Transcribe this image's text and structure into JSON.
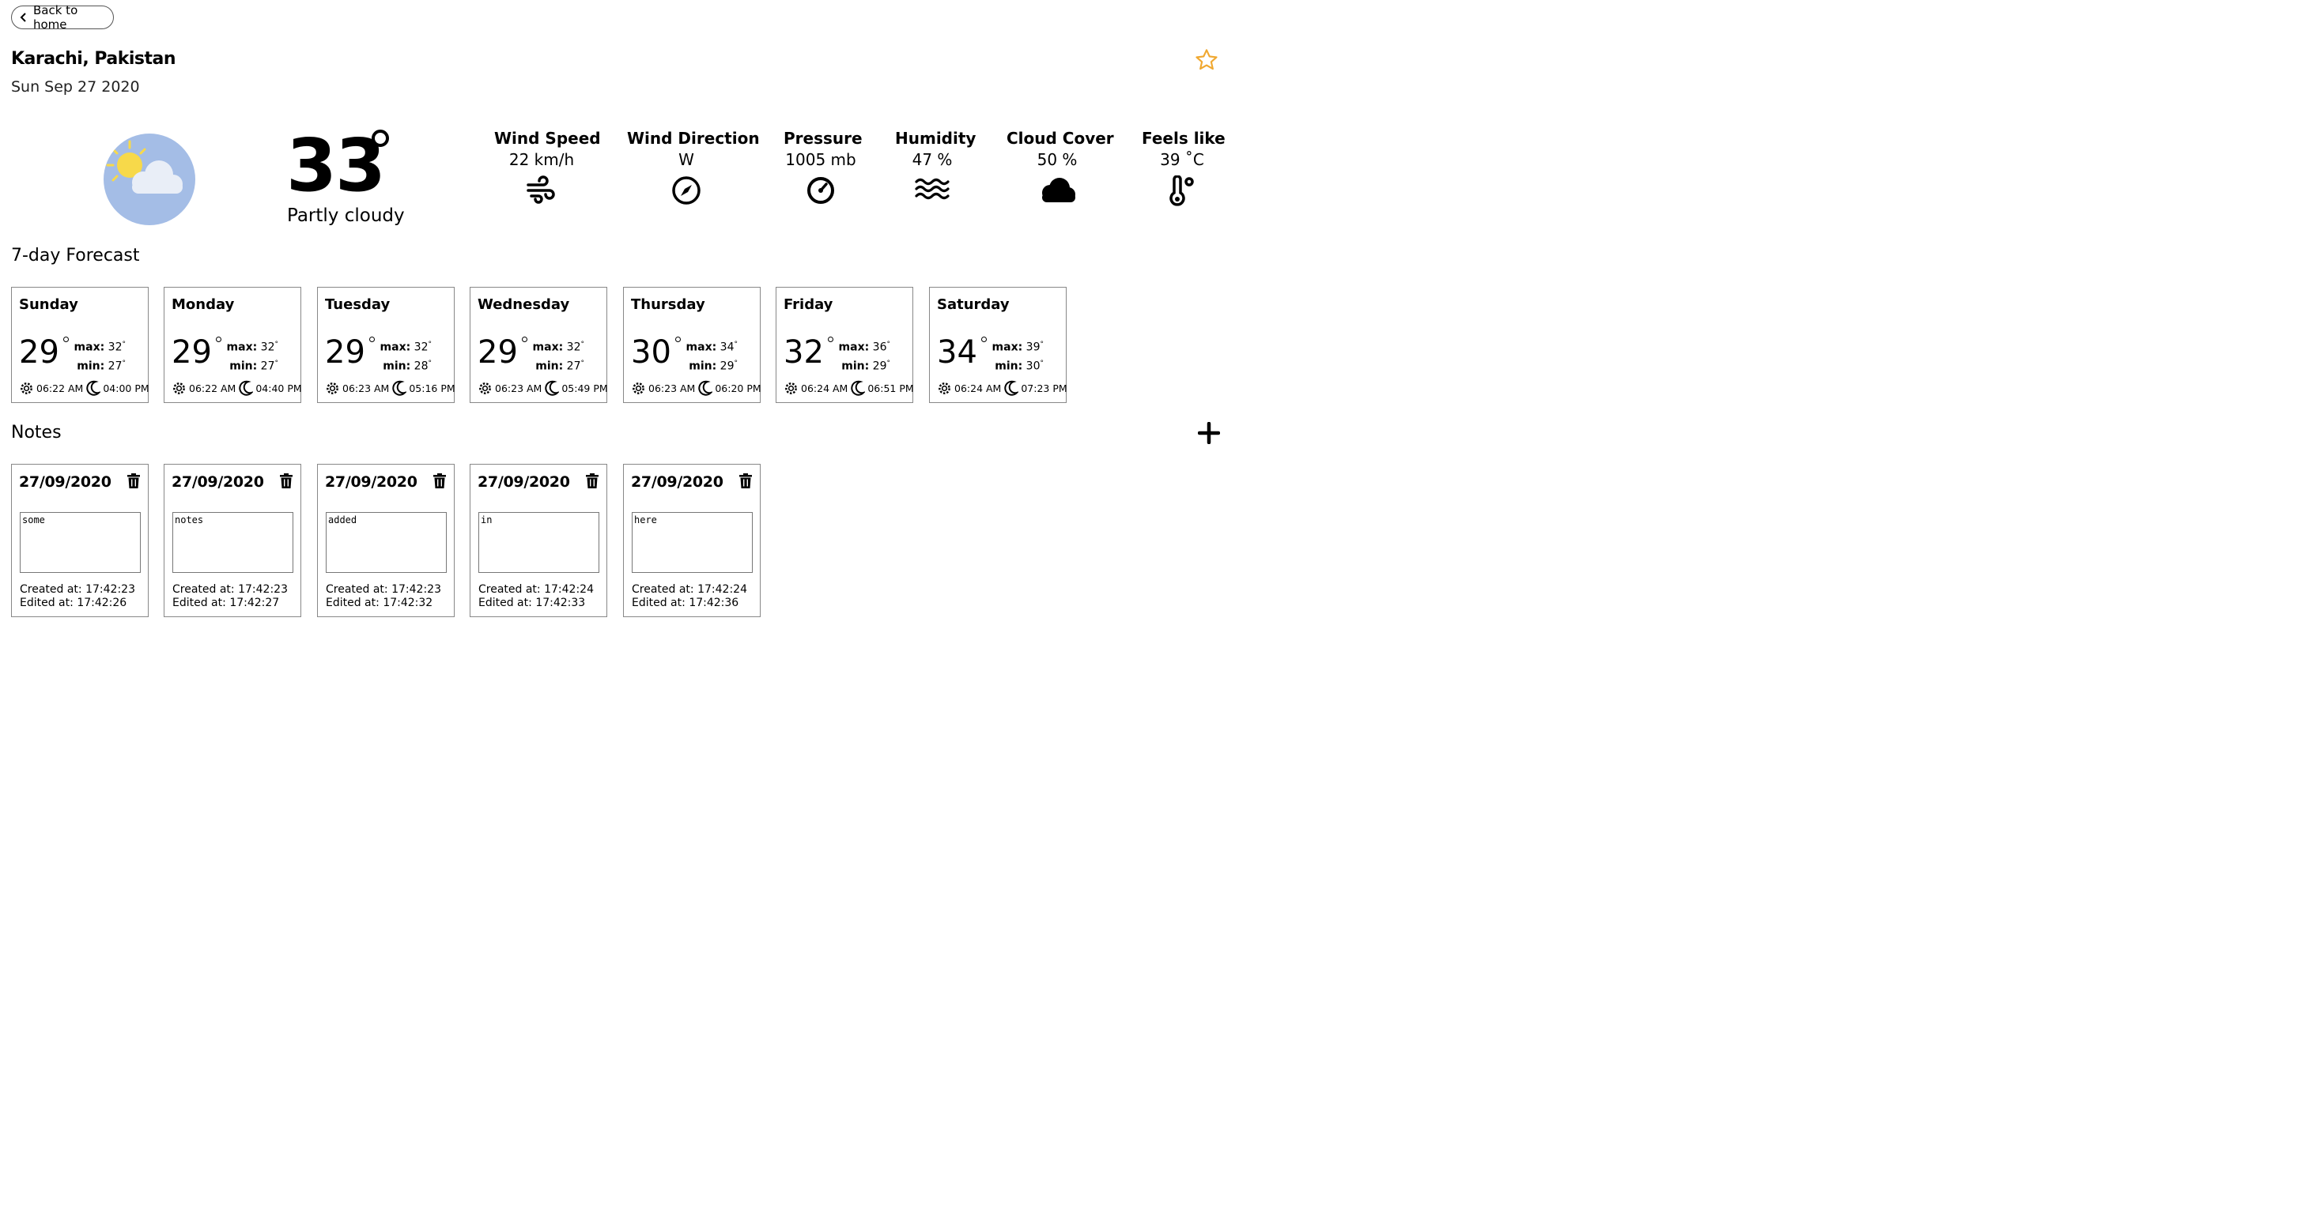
{
  "nav": {
    "back_label": "Back to home"
  },
  "location": {
    "city": "Karachi, Pakistan",
    "date": "Sun Sep 27 2020"
  },
  "current": {
    "temperature": "33",
    "condition": "Partly cloudy"
  },
  "stats": [
    {
      "label": "Wind Speed",
      "value": "22 km/h",
      "icon": "wind-icon"
    },
    {
      "label": "Wind Direction",
      "value": "W",
      "icon": "compass-icon"
    },
    {
      "label": "Pressure",
      "value": "1005 mb",
      "icon": "gauge-icon"
    },
    {
      "label": "Humidity",
      "value": "47 %",
      "icon": "water-waves-icon"
    },
    {
      "label": "Cloud Cover",
      "value": "50 %",
      "icon": "cloud-icon"
    },
    {
      "label": "Feels like",
      "value": "39 ˚C",
      "icon": "thermometer-icon"
    }
  ],
  "forecast": {
    "title": "7-day Forecast",
    "max_label": "max:",
    "min_label": "min:",
    "days": [
      {
        "day": "Sunday",
        "temp": "29",
        "max": "32",
        "min": "27",
        "sunrise": "06:22 AM",
        "sunset": "04:00 PM"
      },
      {
        "day": "Monday",
        "temp": "29",
        "max": "32",
        "min": "27",
        "sunrise": "06:22 AM",
        "sunset": "04:40 PM"
      },
      {
        "day": "Tuesday",
        "temp": "29",
        "max": "32",
        "min": "28",
        "sunrise": "06:23 AM",
        "sunset": "05:16 PM"
      },
      {
        "day": "Wednesday",
        "temp": "29",
        "max": "32",
        "min": "27",
        "sunrise": "06:23 AM",
        "sunset": "05:49 PM"
      },
      {
        "day": "Thursday",
        "temp": "30",
        "max": "34",
        "min": "29",
        "sunrise": "06:23 AM",
        "sunset": "06:20 PM"
      },
      {
        "day": "Friday",
        "temp": "32",
        "max": "36",
        "min": "29",
        "sunrise": "06:24 AM",
        "sunset": "06:51 PM"
      },
      {
        "day": "Saturday",
        "temp": "34",
        "max": "39",
        "min": "30",
        "sunrise": "06:24 AM",
        "sunset": "07:23 PM"
      }
    ]
  },
  "notes": {
    "title": "Notes",
    "created_label": "Created at:",
    "edited_label": "Edited at:",
    "items": [
      {
        "date": "27/09/2020",
        "text": "some",
        "created": "17:42:23",
        "edited": "17:42:26"
      },
      {
        "date": "27/09/2020",
        "text": "notes",
        "created": "17:42:23",
        "edited": "17:42:27"
      },
      {
        "date": "27/09/2020",
        "text": "added",
        "created": "17:42:23",
        "edited": "17:42:32"
      },
      {
        "date": "27/09/2020",
        "text": "in",
        "created": "17:42:24",
        "edited": "17:42:33"
      },
      {
        "date": "27/09/2020",
        "text": "here",
        "created": "17:42:24",
        "edited": "17:42:36"
      }
    ]
  },
  "colors": {
    "star": "#f0a830",
    "illustration_bg": "#a4bde6",
    "sun": "#f7d94a",
    "card_border": "#888888"
  }
}
